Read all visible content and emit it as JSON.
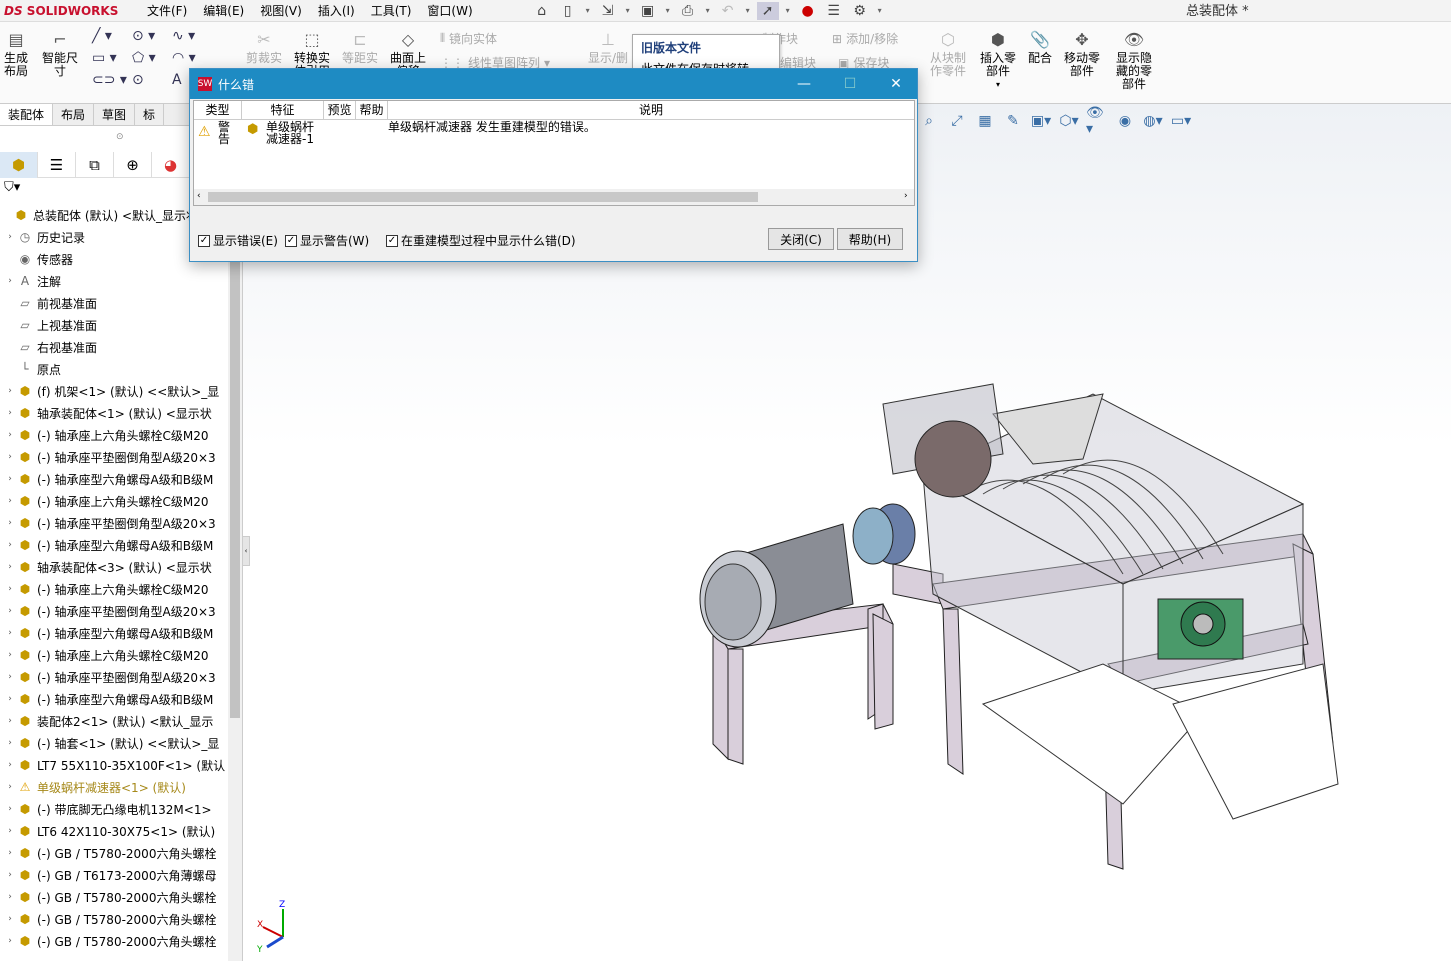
{
  "app": {
    "logo": "SOLIDWORKS",
    "logo_prefix": "DS",
    "doc_title": "总装配体 *"
  },
  "menu": [
    "文件(F)",
    "编辑(E)",
    "视图(V)",
    "插入(I)",
    "工具(T)",
    "窗口(W)"
  ],
  "ribbon": {
    "gen_layout": "生成\n布局",
    "smart_dim": "智能尺\n寸",
    "trim": "剪裁实",
    "convert": "转换实\n体引用",
    "offset": "等距实",
    "surface": "曲面上\n偏移",
    "mirror": "镜向实体",
    "linear_pattern": "线性草图阵列",
    "show_rel": "显示/删",
    "make_block": "制作块",
    "add_remove": "添加/移除",
    "edit_block": "编辑块",
    "save_block": "保存块",
    "from_block": "从块制\n作零件",
    "insert_part": "插入零\n部件",
    "mate": "配合",
    "move_part": "移动零\n部件",
    "show_hidden": "显示隐\n藏的零\n部件"
  },
  "tooltip": {
    "title": "旧版本文件",
    "body": "此文件在保存时将转换。"
  },
  "tabs": [
    "装配体",
    "布局",
    "草图",
    "标"
  ],
  "dialog": {
    "title": "什么错",
    "headers": {
      "type": "类型",
      "feature": "特征",
      "preview": "预览",
      "help": "帮助",
      "desc": "说明"
    },
    "row": {
      "type": "警\n告",
      "feature": "单级蜗杆\n减速器-1",
      "desc": "单级蜗杆减速器 发生重建模型的错误。"
    },
    "show_errors": "显示错误(E)",
    "show_warnings": "显示警告(W)",
    "show_during_rebuild": "在重建模型过程中显示什么错(D)",
    "close": "关闭(C)",
    "help": "帮助(H)"
  },
  "tree": [
    {
      "label": "总装配体 (默认) <默认_显示状",
      "icon": "assembly-icon",
      "expand": false,
      "indent": 0
    },
    {
      "label": "历史记录",
      "icon": "history-icon",
      "expand": true,
      "indent": 1
    },
    {
      "label": "传感器",
      "icon": "sensor-icon",
      "expand": false,
      "indent": 1
    },
    {
      "label": "注解",
      "icon": "annotation-icon",
      "expand": true,
      "indent": 1
    },
    {
      "label": "前视基准面",
      "icon": "plane-icon",
      "expand": false,
      "indent": 1
    },
    {
      "label": "上视基准面",
      "icon": "plane-icon",
      "expand": false,
      "indent": 1
    },
    {
      "label": "右视基准面",
      "icon": "plane-icon",
      "expand": false,
      "indent": 1
    },
    {
      "label": "原点",
      "icon": "origin-icon",
      "expand": false,
      "indent": 1
    },
    {
      "label": "(f) 机架<1> (默认) <<默认>_显",
      "icon": "part-icon",
      "expand": true,
      "indent": 1
    },
    {
      "label": "轴承装配体<1> (默认) <显示状",
      "icon": "assembly-icon",
      "expand": true,
      "indent": 1
    },
    {
      "label": "(-) 轴承座上六角头螺栓C级M20",
      "icon": "part-icon",
      "expand": true,
      "indent": 1
    },
    {
      "label": "(-) 轴承座平垫圈倒角型A级20×3",
      "icon": "part-icon",
      "expand": true,
      "indent": 1
    },
    {
      "label": "(-) 轴承座型六角螺母A级和B级M",
      "icon": "part-icon",
      "expand": true,
      "indent": 1
    },
    {
      "label": "(-) 轴承座上六角头螺栓C级M20",
      "icon": "part-icon",
      "expand": true,
      "indent": 1
    },
    {
      "label": "(-) 轴承座平垫圈倒角型A级20×3",
      "icon": "part-icon",
      "expand": true,
      "indent": 1
    },
    {
      "label": "(-) 轴承座型六角螺母A级和B级M",
      "icon": "part-icon",
      "expand": true,
      "indent": 1
    },
    {
      "label": "轴承装配体<3> (默认) <显示状",
      "icon": "assembly-icon",
      "expand": true,
      "indent": 1
    },
    {
      "label": "(-) 轴承座上六角头螺栓C级M20",
      "icon": "part-icon",
      "expand": true,
      "indent": 1
    },
    {
      "label": "(-) 轴承座平垫圈倒角型A级20×3",
      "icon": "part-icon",
      "expand": true,
      "indent": 1
    },
    {
      "label": "(-) 轴承座型六角螺母A级和B级M",
      "icon": "part-icon",
      "expand": true,
      "indent": 1
    },
    {
      "label": "(-) 轴承座上六角头螺栓C级M20",
      "icon": "part-icon",
      "expand": true,
      "indent": 1
    },
    {
      "label": "(-) 轴承座平垫圈倒角型A级20×3",
      "icon": "part-icon",
      "expand": true,
      "indent": 1
    },
    {
      "label": "(-) 轴承座型六角螺母A级和B级M",
      "icon": "part-icon",
      "expand": true,
      "indent": 1
    },
    {
      "label": "装配体2<1> (默认) <默认_显示",
      "icon": "assembly-icon",
      "expand": true,
      "indent": 1
    },
    {
      "label": "(-) 轴套<1> (默认) <<默认>_显",
      "icon": "part-icon",
      "expand": true,
      "indent": 1
    },
    {
      "label": "LT7 55X110-35X100F<1> (默认",
      "icon": "part-icon",
      "expand": true,
      "indent": 1
    },
    {
      "label": "单级蜗杆减速器<1> (默认)",
      "icon": "warning-icon",
      "expand": true,
      "indent": 1,
      "warn": true
    },
    {
      "label": "(-) 带底脚无凸缘电机132M<1>",
      "icon": "part-icon",
      "expand": true,
      "indent": 1
    },
    {
      "label": "LT6 42X110-30X75<1> (默认)",
      "icon": "part-icon",
      "expand": true,
      "indent": 1
    },
    {
      "label": "(-) GB / T5780-2000六角头螺栓",
      "icon": "part-icon",
      "expand": true,
      "indent": 1
    },
    {
      "label": "(-) GB / T6173-2000六角薄螺母",
      "icon": "part-icon",
      "expand": true,
      "indent": 1
    },
    {
      "label": "(-) GB / T5780-2000六角头螺栓",
      "icon": "part-icon",
      "expand": true,
      "indent": 1
    },
    {
      "label": "(-) GB / T5780-2000六角头螺栓",
      "icon": "part-icon",
      "expand": true,
      "indent": 1
    },
    {
      "label": "(-) GB / T5780-2000六角头螺栓",
      "icon": "part-icon",
      "expand": true,
      "indent": 1
    }
  ],
  "axes": {
    "x": "X",
    "y": "Y",
    "z": "Z"
  }
}
